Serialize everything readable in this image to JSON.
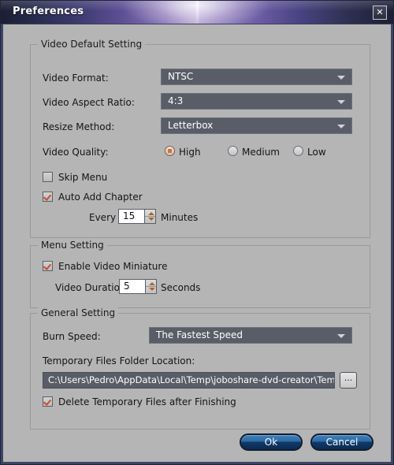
{
  "window": {
    "title": "Preferences",
    "close_label": "✕"
  },
  "video_default_setting": {
    "group_title": "Video Default Setting",
    "video_format": {
      "label": "Video Format:",
      "value": "NTSC"
    },
    "video_aspect_ratio": {
      "label": "Video Aspect Ratio:",
      "value": "4:3"
    },
    "resize_method": {
      "label": "Resize Method:",
      "value": "Letterbox"
    },
    "video_quality": {
      "label": "Video Quality:",
      "options": [
        {
          "label": "High",
          "selected": true
        },
        {
          "label": "Medium",
          "selected": false
        },
        {
          "label": "Low",
          "selected": false
        }
      ]
    },
    "skip_menu": {
      "label": "Skip Menu",
      "checked": false
    },
    "auto_add_chapter": {
      "label": "Auto Add Chapter",
      "checked": true
    },
    "every": {
      "prefix": "Every",
      "value": "15",
      "suffix": "Minutes"
    }
  },
  "menu_setting": {
    "group_title": "Menu Setting",
    "enable_video_miniature": {
      "label": "Enable Video Miniature",
      "checked": true
    },
    "video_duration": {
      "prefix": "Video Duration",
      "value": "5",
      "suffix": "Seconds"
    }
  },
  "general_setting": {
    "group_title": "General Setting",
    "burn_speed": {
      "label": "Burn Speed:",
      "value": "The Fastest Speed"
    },
    "temp_folder": {
      "label": "Temporary Files Folder Location:",
      "value": "C:\\Users\\Pedro\\AppData\\Local\\Temp\\joboshare-dvd-creator\\Temp",
      "browse_label": "..."
    },
    "delete_temp": {
      "label": "Delete Temporary Files after Finishing",
      "checked": true
    }
  },
  "footer": {
    "ok_label": "Ok",
    "cancel_label": "Cancel"
  },
  "colors": {
    "accent_check": "#c4502a",
    "accent_radio": "#d4732c",
    "combo_bg": "#595d68",
    "dialog_bg": "#b5b5b5",
    "button_blue": "#2f6ba4",
    "title_purple": "#8a76b8"
  }
}
